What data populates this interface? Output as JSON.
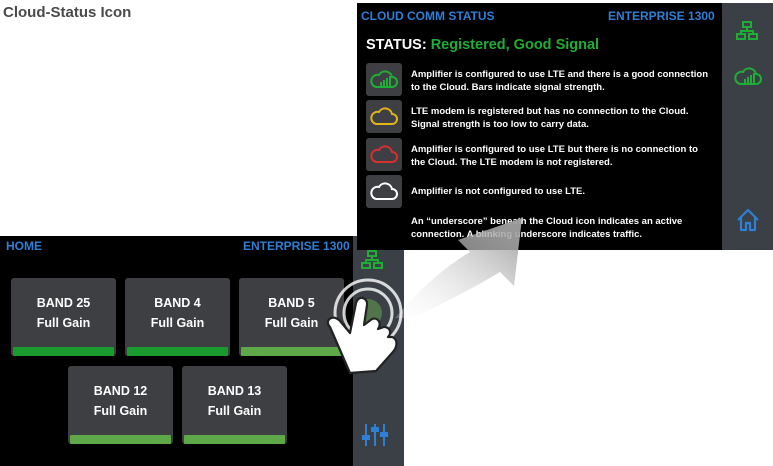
{
  "doc": {
    "title": "Cloud-Status Icon"
  },
  "home": {
    "title": "HOME",
    "model": "ENTERPRISE 1300",
    "bands": [
      {
        "name": "BAND 25",
        "status": "Full Gain",
        "bar": "dark"
      },
      {
        "name": "BAND 4",
        "status": "Full Gain",
        "bar": "dark"
      },
      {
        "name": "BAND 5",
        "status": "Full Gain",
        "bar": "light"
      },
      {
        "name": "BAND 12",
        "status": "Full Gain",
        "bar": "light"
      },
      {
        "name": "BAND 13",
        "status": "Full Gain",
        "bar": "light"
      }
    ],
    "sidebar_icons": [
      "network-icon",
      "cloud-signal-icon",
      "sliders-icon"
    ]
  },
  "cloud": {
    "title": "CLOUD COMM STATUS",
    "model": "ENTERPRISE 1300",
    "status_label": "STATUS:",
    "status_value": "Registered, Good Signal",
    "rows": [
      {
        "icon": "cloud-green-signal-icon",
        "color": "#1fae35",
        "text": "Amplifier is configured to use LTE and there is a good connection to the Cloud. Bars indicate signal strength."
      },
      {
        "icon": "cloud-yellow-icon",
        "color": "#e0b418",
        "text": "LTE modem is registered but has no connection to the Cloud. Signal strength is too low to carry data."
      },
      {
        "icon": "cloud-red-icon",
        "color": "#d63030",
        "text": "Amplifier is configured to use LTE but there is no connection to the Cloud. The LTE modem is not registered."
      },
      {
        "icon": "cloud-white-icon",
        "color": "#ffffff",
        "text": "Amplifier is not configured to use LTE."
      }
    ],
    "note": "An “underscore” beneath the Cloud icon indicates an active connection. A blinking underscore indicates traffic.",
    "sidebar_icons": [
      "network-icon",
      "cloud-signal-icon",
      "home-icon"
    ]
  },
  "colors": {
    "header_blue": "#2e7fd6",
    "green": "#1fae35",
    "sidebar": "#3b4047",
    "tile": "#3d3f43"
  }
}
